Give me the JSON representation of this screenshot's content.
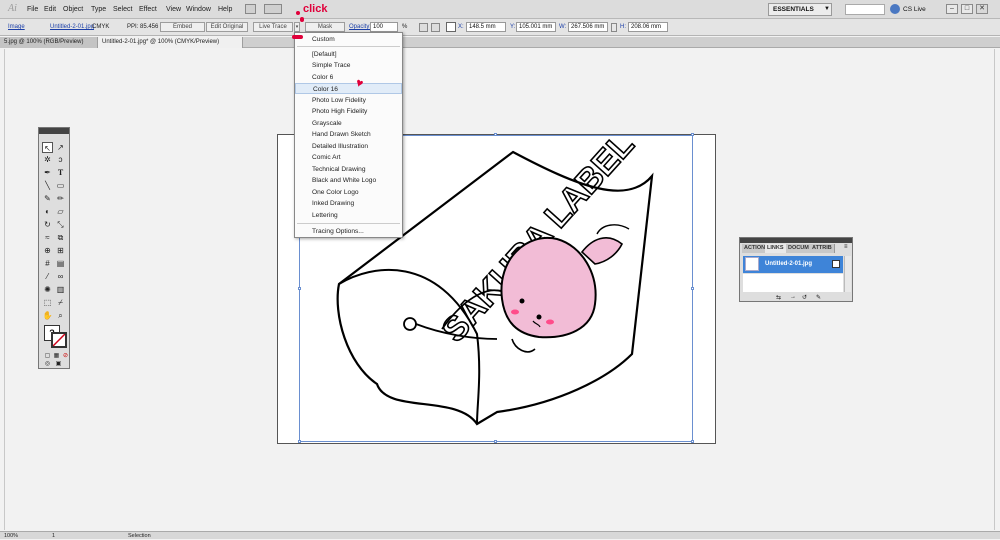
{
  "menubar": {
    "logo": "Ai",
    "items": [
      "File",
      "Edit",
      "Object",
      "Type",
      "Select",
      "Effect",
      "View",
      "Window",
      "Help"
    ],
    "workspace": "ESSENTIALS",
    "cs_live": "CS Live",
    "win_min": "–",
    "win_max": "□",
    "win_close": "✕"
  },
  "control_bar": {
    "image_label": "Image",
    "filename": "Untitled-2-01.jpg",
    "color_mode": "CMYK",
    "ppi": "PPI: 85.456",
    "embed": "Embed",
    "edit_original": "Edit Original",
    "live_trace": "Live Trace",
    "mask": "Mask",
    "opacity_label": "Opacity:",
    "opacity_value": "100",
    "opacity_unit": "%",
    "x_label": "X:",
    "x_value": "148.5 mm",
    "y_label": "Y:",
    "y_value": "105.001 mm",
    "w_label": "W:",
    "w_value": "267.506 mm",
    "h_label": "H:",
    "h_value": "208.06 mm"
  },
  "doc_tabs": [
    {
      "label": "5.jpg @ 100% (RGB/Preview)"
    },
    {
      "label": "Untitled-2-01.jpg* @ 100% (CMYK/Preview)"
    }
  ],
  "dropdown": {
    "items": [
      "Custom",
      "[Default]",
      "Simple Trace",
      "Color 6",
      "Color 16",
      "Photo Low Fidelity",
      "Photo High Fidelity",
      "Grayscale",
      "Hand Drawn Sketch",
      "Detailed Illustration",
      "Comic Art",
      "Technical Drawing",
      "Black and White Logo",
      "One Color Logo",
      "Inked Drawing",
      "Lettering",
      "Tracing Options..."
    ],
    "highlighted": "Color 16"
  },
  "artwork": {
    "banner_text": "SAKURA LABEL"
  },
  "links_panel": {
    "tabs": [
      "ACTION",
      "LINKS",
      "DOCUM",
      "ATTRIB"
    ],
    "file": "Untitled-2-01.jpg"
  },
  "status_bar": {
    "zoom": "100%",
    "page": "1",
    "tool": "Selection"
  },
  "annotation": {
    "text": "click"
  },
  "colors": {
    "highlight": "#3e84d8",
    "annotation": "#e0003a",
    "character_pink": "#f2bcd6"
  }
}
